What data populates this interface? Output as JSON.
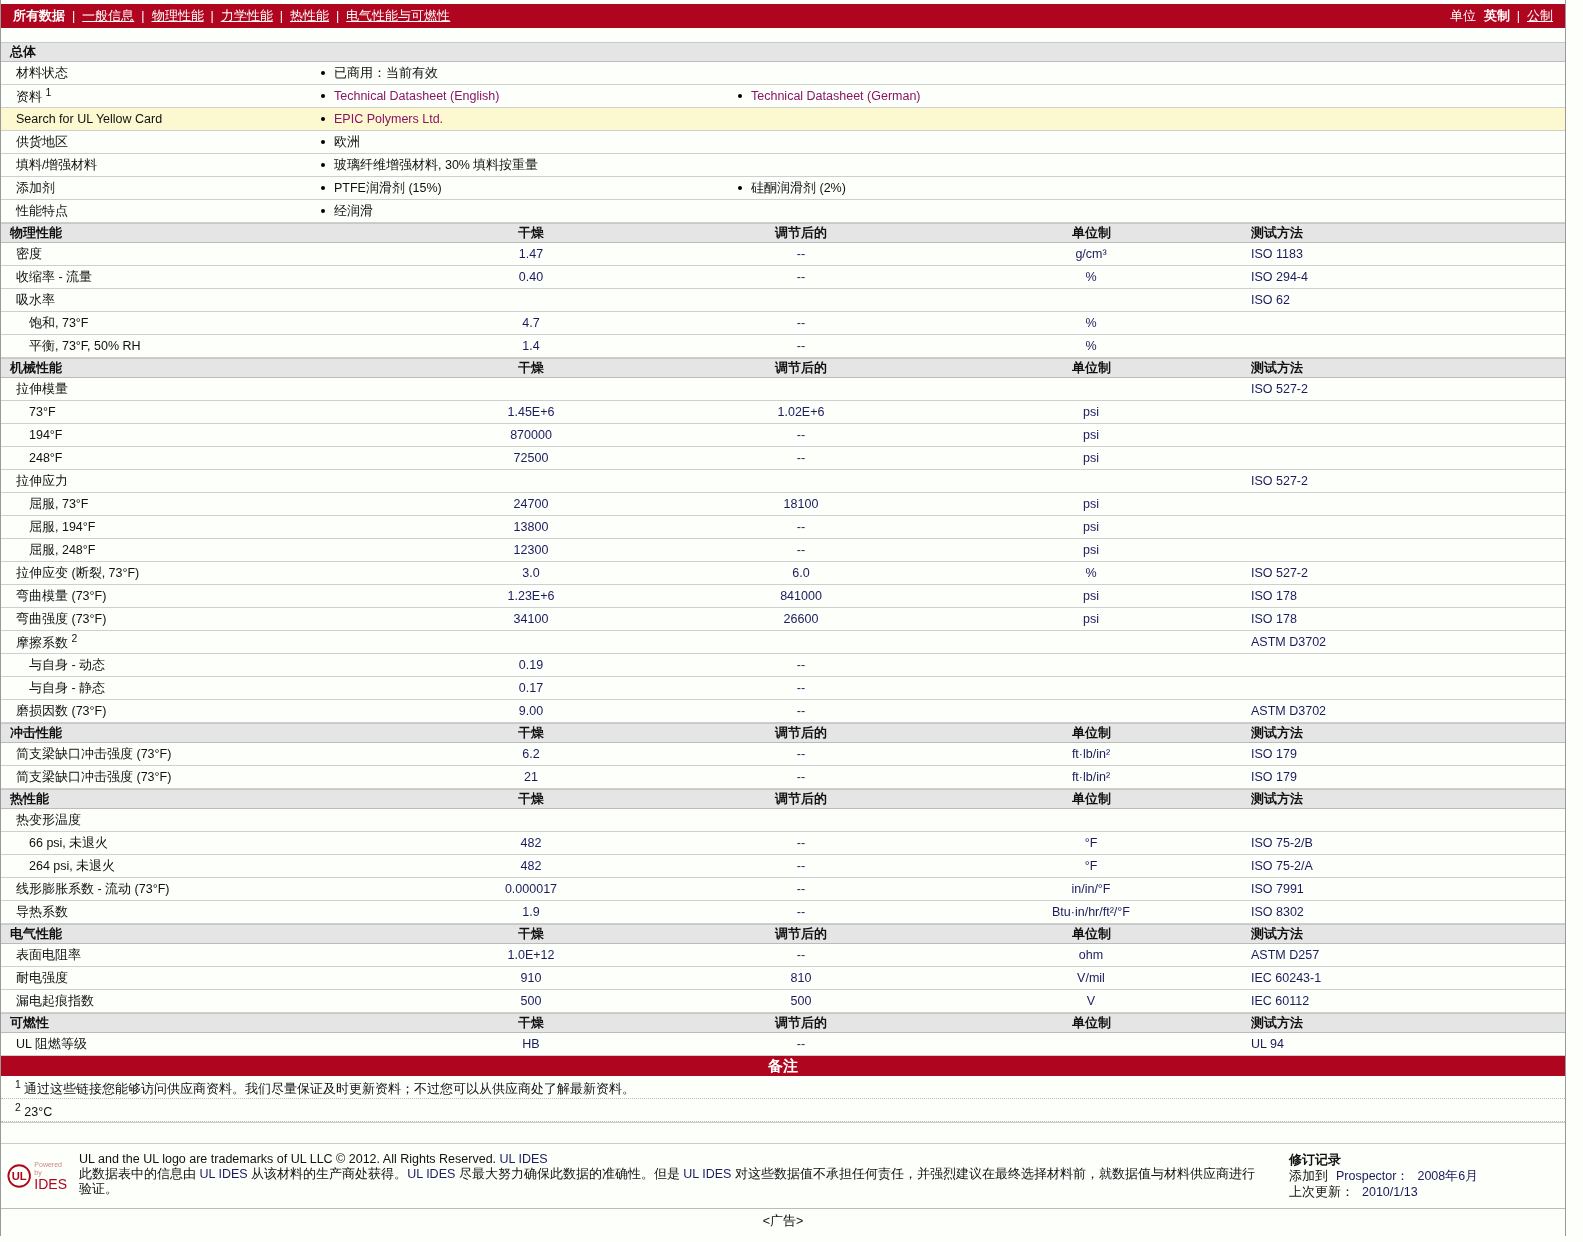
{
  "top_nav": {
    "items": [
      {
        "label": "所有数据",
        "selected": true
      },
      {
        "label": "一般信息",
        "selected": false
      },
      {
        "label": "物理性能",
        "selected": false
      },
      {
        "label": "力学性能",
        "selected": false
      },
      {
        "label": "热性能",
        "selected": false
      },
      {
        "label": "电气性能与可燃性",
        "selected": false
      }
    ],
    "separator": "|",
    "units": {
      "label": "单位",
      "options": [
        {
          "label": "英制",
          "selected": true
        },
        {
          "label": "公制",
          "selected": false
        }
      ]
    }
  },
  "general": {
    "title": "总体",
    "rows": [
      {
        "label": "材料状态",
        "highlighted": false,
        "values": [
          {
            "text": "已商用：当前有效",
            "kind": "text"
          }
        ]
      },
      {
        "label": "资料 $^{1}$",
        "highlighted": false,
        "values": [
          {
            "text": "Technical Datasheet (English)",
            "kind": "link"
          },
          {
            "text": "Technical Datasheet (German)",
            "kind": "link"
          }
        ]
      },
      {
        "label": "Search for UL Yellow Card",
        "highlighted": true,
        "values": [
          {
            "text": "EPIC Polymers Ltd.",
            "kind": "link"
          }
        ]
      },
      {
        "label": "供货地区",
        "highlighted": false,
        "values": [
          {
            "text": "欧洲",
            "kind": "text"
          }
        ]
      },
      {
        "label": "填料/增强材料",
        "highlighted": false,
        "values": [
          {
            "text": "玻璃纤维增强材料, 30% 填料按重量",
            "kind": "text"
          }
        ]
      },
      {
        "label": "添加剂",
        "highlighted": false,
        "values": [
          {
            "text": "PTFE润滑剂 (15%)",
            "kind": "text"
          },
          {
            "text": "硅酮润滑剂 (2%)",
            "kind": "text"
          }
        ]
      },
      {
        "label": "性能特点",
        "highlighted": false,
        "values": [
          {
            "text": "经润滑",
            "kind": "text"
          }
        ]
      }
    ]
  },
  "sections": [
    {
      "title": "物理性能",
      "columns": [
        "干燥",
        "调节后的",
        "单位制",
        "测试方法"
      ],
      "rows": [
        {
          "label": "密度",
          "dry": "1.47",
          "conditioned": "--",
          "unit": "g/cm³",
          "method": "ISO 1183"
        },
        {
          "label": "收缩率 - 流量",
          "dry": "0.40",
          "conditioned": "--",
          "unit": "%",
          "method": "ISO 294-4"
        },
        {
          "label": "吸水率",
          "method": "ISO 62",
          "children": [
            {
              "label": "饱和, 73°F",
              "dry": "4.7",
              "conditioned": "--",
              "unit": "%"
            },
            {
              "label": "平衡, 73°F, 50% RH",
              "dry": "1.4",
              "conditioned": "--",
              "unit": "%"
            }
          ]
        }
      ]
    },
    {
      "title": "机械性能",
      "columns": [
        "干燥",
        "调节后的",
        "单位制",
        "测试方法"
      ],
      "rows": [
        {
          "label": "拉伸模量",
          "method": "ISO 527-2",
          "children": [
            {
              "label": "73°F",
              "dry": "1.45E+6",
              "conditioned": "1.02E+6",
              "unit": "psi"
            },
            {
              "label": "194°F",
              "dry": "870000",
              "conditioned": "--",
              "unit": "psi"
            },
            {
              "label": "248°F",
              "dry": "72500",
              "conditioned": "--",
              "unit": "psi"
            }
          ]
        },
        {
          "label": "拉伸应力",
          "method": "ISO 527-2",
          "children": [
            {
              "label": "屈服, 73°F",
              "dry": "24700",
              "conditioned": "18100",
              "unit": "psi"
            },
            {
              "label": "屈服, 194°F",
              "dry": "13800",
              "conditioned": "--",
              "unit": "psi"
            },
            {
              "label": "屈服, 248°F",
              "dry": "12300",
              "conditioned": "--",
              "unit": "psi"
            }
          ]
        },
        {
          "label": "拉伸应变 (断裂, 73°F)",
          "dry": "3.0",
          "conditioned": "6.0",
          "unit": "%",
          "method": "ISO 527-2"
        },
        {
          "label": "弯曲模量 (73°F)",
          "dry": "1.23E+6",
          "conditioned": "841000",
          "unit": "psi",
          "method": "ISO 178"
        },
        {
          "label": "弯曲强度 (73°F)",
          "dry": "34100",
          "conditioned": "26600",
          "unit": "psi",
          "method": "ISO 178"
        },
        {
          "label": "摩擦系数 $^{2}$",
          "method": "ASTM D3702",
          "children": [
            {
              "label": "与自身 - 动态",
              "dry": "0.19",
              "conditioned": "--"
            },
            {
              "label": "与自身 - 静态",
              "dry": "0.17",
              "conditioned": "--"
            }
          ]
        },
        {
          "label": "磨损因数 (73°F)",
          "dry": "9.00",
          "conditioned": "--",
          "method": "ASTM D3702"
        }
      ]
    },
    {
      "title": "冲击性能",
      "columns": [
        "干燥",
        "调节后的",
        "单位制",
        "测试方法"
      ],
      "rows": [
        {
          "label": "简支梁缺口冲击强度 (73°F)",
          "dry": "6.2",
          "conditioned": "--",
          "unit": "ft·lb/in²",
          "method": "ISO 179"
        },
        {
          "label": "简支梁缺口冲击强度 (73°F)",
          "dry": "21",
          "conditioned": "--",
          "unit": "ft·lb/in²",
          "method": "ISO 179"
        }
      ]
    },
    {
      "title": "热性能",
      "columns": [
        "干燥",
        "调节后的",
        "单位制",
        "测试方法"
      ],
      "rows": [
        {
          "label": "热变形温度",
          "children": [
            {
              "label": "66 psi, 未退火",
              "dry": "482",
              "conditioned": "--",
              "unit": "°F",
              "method": "ISO 75-2/B"
            },
            {
              "label": "264 psi, 未退火",
              "dry": "482",
              "conditioned": "--",
              "unit": "°F",
              "method": "ISO 75-2/A"
            }
          ]
        },
        {
          "label": "线形膨胀系数 - 流动 (73°F)",
          "dry": "0.000017",
          "conditioned": "--",
          "unit": "in/in/°F",
          "method": "ISO 7991"
        },
        {
          "label": "导热系数",
          "dry": "1.9",
          "conditioned": "--",
          "unit": "Btu·in/hr/ft²/°F",
          "method": "ISO 8302"
        }
      ]
    },
    {
      "title": "电气性能",
      "columns": [
        "干燥",
        "调节后的",
        "单位制",
        "测试方法"
      ],
      "rows": [
        {
          "label": "表面电阻率",
          "dry": "1.0E+12",
          "conditioned": "--",
          "unit": "ohm",
          "method": "ASTM D257"
        },
        {
          "label": "耐电强度",
          "dry": "910",
          "conditioned": "810",
          "unit": "V/mil",
          "method": "IEC 60243-1"
        },
        {
          "label": "漏电起痕指数",
          "dry": "500",
          "conditioned": "500",
          "unit": "V",
          "method": "IEC 60112"
        }
      ]
    },
    {
      "title": "可燃性",
      "columns": [
        "干燥",
        "调节后的",
        "单位制",
        "测试方法"
      ],
      "rows": [
        {
          "label": "UL 阻燃等级",
          "dry": "HB",
          "conditioned": "--",
          "method": "UL 94"
        }
      ]
    }
  ],
  "notes": {
    "title": "备注",
    "items": [
      "$^{1}$ 通过这些链接您能够访问供应商资料。我们尽量保证及时更新资料；不过您可以从供应商处了解最新资料。",
      "$^{2}$ 23°C"
    ]
  },
  "footer": {
    "logo": {
      "mark": "UL",
      "powered": "Powered by",
      "brand": "IDES"
    },
    "legal": [
      {
        "text": "UL and the UL logo are trademarks of UL LLC © 2012. All Rights Reserved. ",
        "link": false
      },
      {
        "text": "UL IDES",
        "link": true
      }
    ],
    "disclaimer": [
      {
        "text": "此数据表中的信息由 ",
        "link": false
      },
      {
        "text": "UL IDES",
        "link": true
      },
      {
        "text": " 从该材料的生产商处获得。",
        "link": false
      },
      {
        "text": "UL IDES",
        "link": true
      },
      {
        "text": " 尽最大努力确保此数据的准确性。但是 ",
        "link": false
      },
      {
        "text": "UL IDES",
        "link": true
      },
      {
        "text": " 对这些数据值不承担任何责任，并强烈建议在最终选择材料前，就数据值与材料供应商进行验证。",
        "link": false
      }
    ],
    "revision": {
      "title": "修订记录",
      "rows": [
        {
          "label": "添加到",
          "link": "Prospector：",
          "value": "2008年6月"
        },
        {
          "label": "上次更新：",
          "value": "2010/1/13"
        }
      ]
    }
  },
  "ad": "<广告>"
}
